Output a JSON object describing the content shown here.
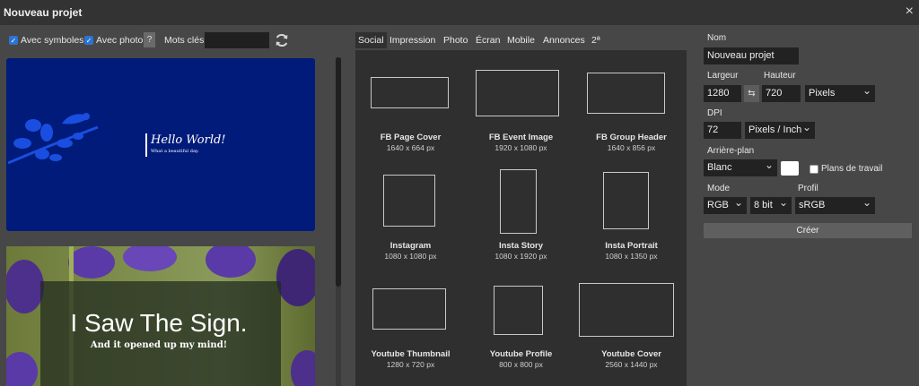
{
  "dialog": {
    "title": "Nouveau projet",
    "close_glyph": "×"
  },
  "filters": {
    "with_symbols_label": "Avec symboles",
    "with_symbols_checked": true,
    "with_photo_label": "Avec photo",
    "with_photo_checked": true,
    "help_label": "?",
    "keywords_label": "Mots clés:",
    "keywords_value": ""
  },
  "templates": [
    {
      "title": "Hello World!",
      "subtitle": "What a beautiful day."
    },
    {
      "title": "I Saw The Sign.",
      "subtitle": "And it opened up my mind!"
    }
  ],
  "tabs": [
    "Social",
    "Impression",
    "Photo",
    "Écran",
    "Mobile",
    "Annonces",
    "2ª"
  ],
  "active_tab": "Social",
  "presets": [
    {
      "name": "FB Page Cover",
      "size": "1640 x 664 px"
    },
    {
      "name": "FB Event Image",
      "size": "1920 x 1080 px"
    },
    {
      "name": "FB Group Header",
      "size": "1640 x 856 px"
    },
    {
      "name": "Instagram",
      "size": "1080 x 1080 px"
    },
    {
      "name": "Insta Story",
      "size": "1080 x 1920 px"
    },
    {
      "name": "Insta Portrait",
      "size": "1080 x 1350 px"
    },
    {
      "name": "Youtube Thumbnail",
      "size": "1280 x 720 px"
    },
    {
      "name": "Youtube Profile",
      "size": "800 x 800 px"
    },
    {
      "name": "Youtube Cover",
      "size": "2560 x 1440 px"
    }
  ],
  "settings": {
    "name_label": "Nom",
    "name_value": "Nouveau projet",
    "width_label": "Largeur",
    "width_value": "1280",
    "height_label": "Hauteur",
    "height_value": "720",
    "swap_glyph": "⇆",
    "unit_value": "Pixels",
    "dpi_label": "DPI",
    "dpi_value": "72",
    "dpi_unit_value": "Pixels / Inch",
    "background_label": "Arrière-plan",
    "background_value": "Blanc",
    "background_color": "#ffffff",
    "artboards_label": "Plans de travail",
    "artboards_checked": false,
    "mode_label": "Mode",
    "mode_value": "RGB",
    "bits_value": "8 bit",
    "profile_label": "Profil",
    "profile_value": "sRGB",
    "create_label": "Créer"
  },
  "colors": {
    "accent": "#2c73d2",
    "template_blue": "#001b7a"
  }
}
